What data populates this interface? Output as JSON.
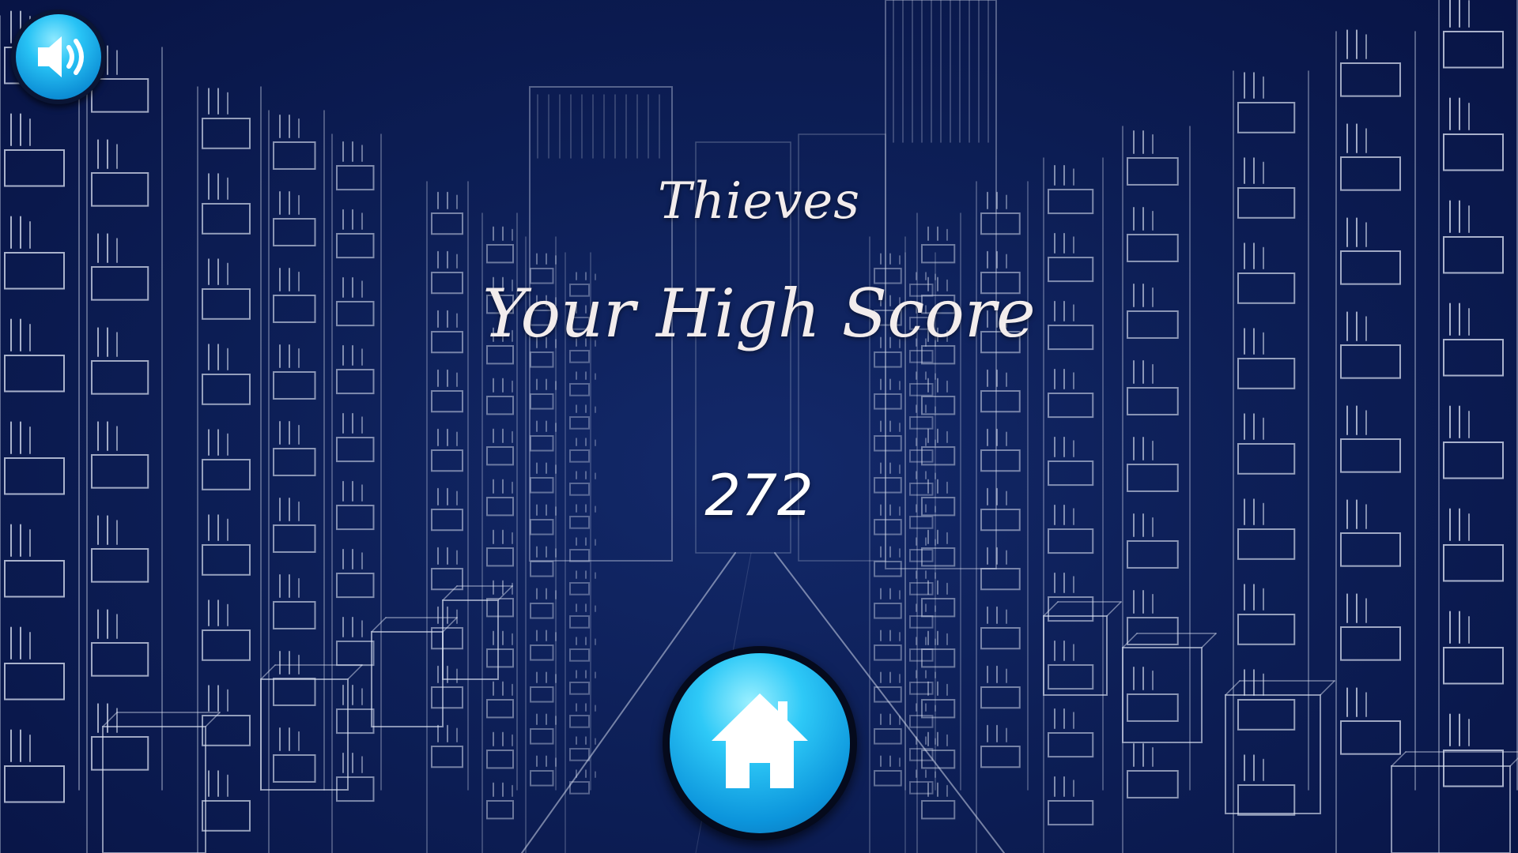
{
  "game": {
    "title": "Thieves",
    "score_heading": "Your High Score",
    "high_score": "272"
  },
  "controls": {
    "sound_icon": "speaker-volume-icon",
    "home_icon": "home-icon"
  },
  "colors": {
    "background": "#0d1f57",
    "button_blue": "#1fb6ef",
    "text": "#f2ecec"
  }
}
